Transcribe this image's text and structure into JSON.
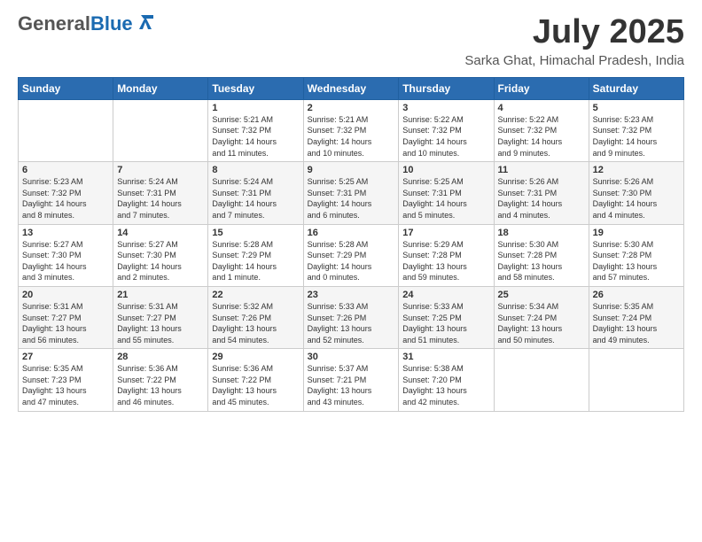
{
  "header": {
    "logo_general": "General",
    "logo_blue": "Blue",
    "month": "July 2025",
    "location": "Sarka Ghat, Himachal Pradesh, India"
  },
  "weekdays": [
    "Sunday",
    "Monday",
    "Tuesday",
    "Wednesday",
    "Thursday",
    "Friday",
    "Saturday"
  ],
  "weeks": [
    [
      {
        "day": "",
        "info": ""
      },
      {
        "day": "",
        "info": ""
      },
      {
        "day": "1",
        "info": "Sunrise: 5:21 AM\nSunset: 7:32 PM\nDaylight: 14 hours\nand 11 minutes."
      },
      {
        "day": "2",
        "info": "Sunrise: 5:21 AM\nSunset: 7:32 PM\nDaylight: 14 hours\nand 10 minutes."
      },
      {
        "day": "3",
        "info": "Sunrise: 5:22 AM\nSunset: 7:32 PM\nDaylight: 14 hours\nand 10 minutes."
      },
      {
        "day": "4",
        "info": "Sunrise: 5:22 AM\nSunset: 7:32 PM\nDaylight: 14 hours\nand 9 minutes."
      },
      {
        "day": "5",
        "info": "Sunrise: 5:23 AM\nSunset: 7:32 PM\nDaylight: 14 hours\nand 9 minutes."
      }
    ],
    [
      {
        "day": "6",
        "info": "Sunrise: 5:23 AM\nSunset: 7:32 PM\nDaylight: 14 hours\nand 8 minutes."
      },
      {
        "day": "7",
        "info": "Sunrise: 5:24 AM\nSunset: 7:31 PM\nDaylight: 14 hours\nand 7 minutes."
      },
      {
        "day": "8",
        "info": "Sunrise: 5:24 AM\nSunset: 7:31 PM\nDaylight: 14 hours\nand 7 minutes."
      },
      {
        "day": "9",
        "info": "Sunrise: 5:25 AM\nSunset: 7:31 PM\nDaylight: 14 hours\nand 6 minutes."
      },
      {
        "day": "10",
        "info": "Sunrise: 5:25 AM\nSunset: 7:31 PM\nDaylight: 14 hours\nand 5 minutes."
      },
      {
        "day": "11",
        "info": "Sunrise: 5:26 AM\nSunset: 7:31 PM\nDaylight: 14 hours\nand 4 minutes."
      },
      {
        "day": "12",
        "info": "Sunrise: 5:26 AM\nSunset: 7:30 PM\nDaylight: 14 hours\nand 4 minutes."
      }
    ],
    [
      {
        "day": "13",
        "info": "Sunrise: 5:27 AM\nSunset: 7:30 PM\nDaylight: 14 hours\nand 3 minutes."
      },
      {
        "day": "14",
        "info": "Sunrise: 5:27 AM\nSunset: 7:30 PM\nDaylight: 14 hours\nand 2 minutes."
      },
      {
        "day": "15",
        "info": "Sunrise: 5:28 AM\nSunset: 7:29 PM\nDaylight: 14 hours\nand 1 minute."
      },
      {
        "day": "16",
        "info": "Sunrise: 5:28 AM\nSunset: 7:29 PM\nDaylight: 14 hours\nand 0 minutes."
      },
      {
        "day": "17",
        "info": "Sunrise: 5:29 AM\nSunset: 7:28 PM\nDaylight: 13 hours\nand 59 minutes."
      },
      {
        "day": "18",
        "info": "Sunrise: 5:30 AM\nSunset: 7:28 PM\nDaylight: 13 hours\nand 58 minutes."
      },
      {
        "day": "19",
        "info": "Sunrise: 5:30 AM\nSunset: 7:28 PM\nDaylight: 13 hours\nand 57 minutes."
      }
    ],
    [
      {
        "day": "20",
        "info": "Sunrise: 5:31 AM\nSunset: 7:27 PM\nDaylight: 13 hours\nand 56 minutes."
      },
      {
        "day": "21",
        "info": "Sunrise: 5:31 AM\nSunset: 7:27 PM\nDaylight: 13 hours\nand 55 minutes."
      },
      {
        "day": "22",
        "info": "Sunrise: 5:32 AM\nSunset: 7:26 PM\nDaylight: 13 hours\nand 54 minutes."
      },
      {
        "day": "23",
        "info": "Sunrise: 5:33 AM\nSunset: 7:26 PM\nDaylight: 13 hours\nand 52 minutes."
      },
      {
        "day": "24",
        "info": "Sunrise: 5:33 AM\nSunset: 7:25 PM\nDaylight: 13 hours\nand 51 minutes."
      },
      {
        "day": "25",
        "info": "Sunrise: 5:34 AM\nSunset: 7:24 PM\nDaylight: 13 hours\nand 50 minutes."
      },
      {
        "day": "26",
        "info": "Sunrise: 5:35 AM\nSunset: 7:24 PM\nDaylight: 13 hours\nand 49 minutes."
      }
    ],
    [
      {
        "day": "27",
        "info": "Sunrise: 5:35 AM\nSunset: 7:23 PM\nDaylight: 13 hours\nand 47 minutes."
      },
      {
        "day": "28",
        "info": "Sunrise: 5:36 AM\nSunset: 7:22 PM\nDaylight: 13 hours\nand 46 minutes."
      },
      {
        "day": "29",
        "info": "Sunrise: 5:36 AM\nSunset: 7:22 PM\nDaylight: 13 hours\nand 45 minutes."
      },
      {
        "day": "30",
        "info": "Sunrise: 5:37 AM\nSunset: 7:21 PM\nDaylight: 13 hours\nand 43 minutes."
      },
      {
        "day": "31",
        "info": "Sunrise: 5:38 AM\nSunset: 7:20 PM\nDaylight: 13 hours\nand 42 minutes."
      },
      {
        "day": "",
        "info": ""
      },
      {
        "day": "",
        "info": ""
      }
    ]
  ]
}
